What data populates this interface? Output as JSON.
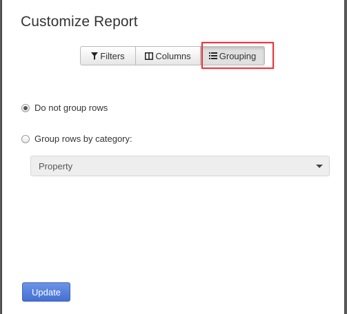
{
  "dialog": {
    "title": "Customize Report"
  },
  "tabs": [
    {
      "label": "Filters",
      "icon": "filter-icon"
    },
    {
      "label": "Columns",
      "icon": "columns-icon"
    },
    {
      "label": "Grouping",
      "icon": "list-icon",
      "active": true
    }
  ],
  "grouping": {
    "option_none": "Do not group rows",
    "option_category": "Group rows by category:",
    "selected": "option_none",
    "category_select_value": "Property"
  },
  "footer": {
    "update_label": "Update"
  },
  "colors": {
    "highlight": "#e2363c",
    "primary_button": "#4f7bdc"
  }
}
